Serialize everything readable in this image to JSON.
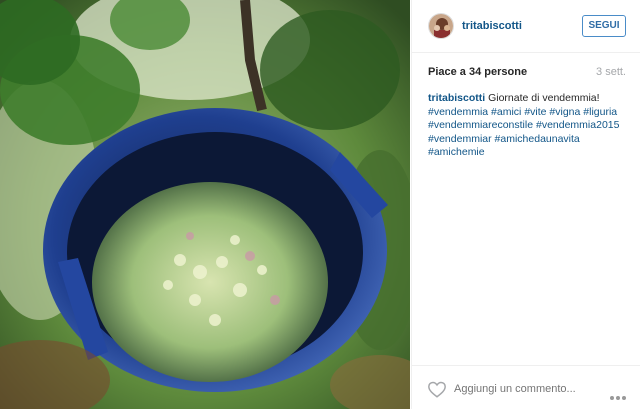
{
  "post": {
    "photo_icon": "vineyard-photo",
    "user": {
      "username": "tritabiscotti",
      "avatar_icon": "avatar-icon"
    },
    "follow_label": "SEGUI",
    "likes_text": "Piace a 34 persone",
    "time_ago": "3 sett.",
    "caption": {
      "username": "tritabiscotti",
      "text": "Giornate di vendemmia!",
      "hashtags": [
        "#vendemmia",
        "#amici",
        "#vite",
        "#vigna",
        "#liguria",
        "#vendemmiareconstile",
        "#vendemmia2015",
        "#vendemmiar",
        "#amichedaunavita",
        "#amichemie"
      ]
    },
    "comment_placeholder": "Aggiungi un commento...",
    "icons": {
      "like": "heart-icon",
      "more": "more-options-icon"
    }
  }
}
